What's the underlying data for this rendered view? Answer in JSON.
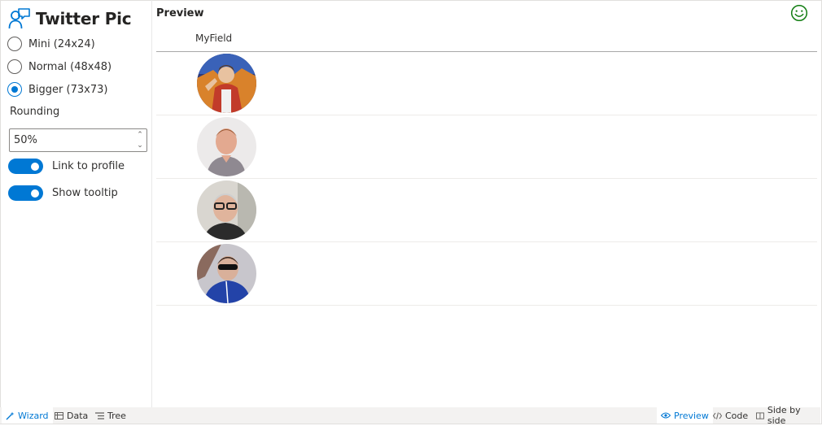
{
  "app": {
    "title": "Twitter Pic",
    "icon": "person-comment-icon",
    "accent": "#0078d4"
  },
  "size_options": [
    {
      "label": "Mini (24x24)",
      "selected": false
    },
    {
      "label": "Normal (48x48)",
      "selected": false
    },
    {
      "label": "Bigger (73x73)",
      "selected": true
    }
  ],
  "rounding": {
    "label": "Rounding",
    "value": "50%"
  },
  "toggles": [
    {
      "label": "Link to profile",
      "on": true
    },
    {
      "label": "Show tooltip",
      "on": true
    }
  ],
  "preview": {
    "title": "Preview",
    "status_icon": "smiley-icon",
    "status_color": "#107c10",
    "column_header": "MyField",
    "rows": [
      {
        "avatar": "avatar-1"
      },
      {
        "avatar": "avatar-2"
      },
      {
        "avatar": "avatar-3"
      },
      {
        "avatar": "avatar-4"
      }
    ]
  },
  "bottom_tabs_left": [
    {
      "label": "Wizard",
      "icon": "wand-icon",
      "active": true
    },
    {
      "label": "Data",
      "icon": "table-icon",
      "active": false
    },
    {
      "label": "Tree",
      "icon": "tree-list-icon",
      "active": false
    }
  ],
  "bottom_tabs_right": [
    {
      "label": "Preview",
      "icon": "eye-icon",
      "active": true
    },
    {
      "label": "Code",
      "icon": "code-icon",
      "active": false
    },
    {
      "label": "Side by side",
      "icon": "columns-icon",
      "active": false
    }
  ]
}
